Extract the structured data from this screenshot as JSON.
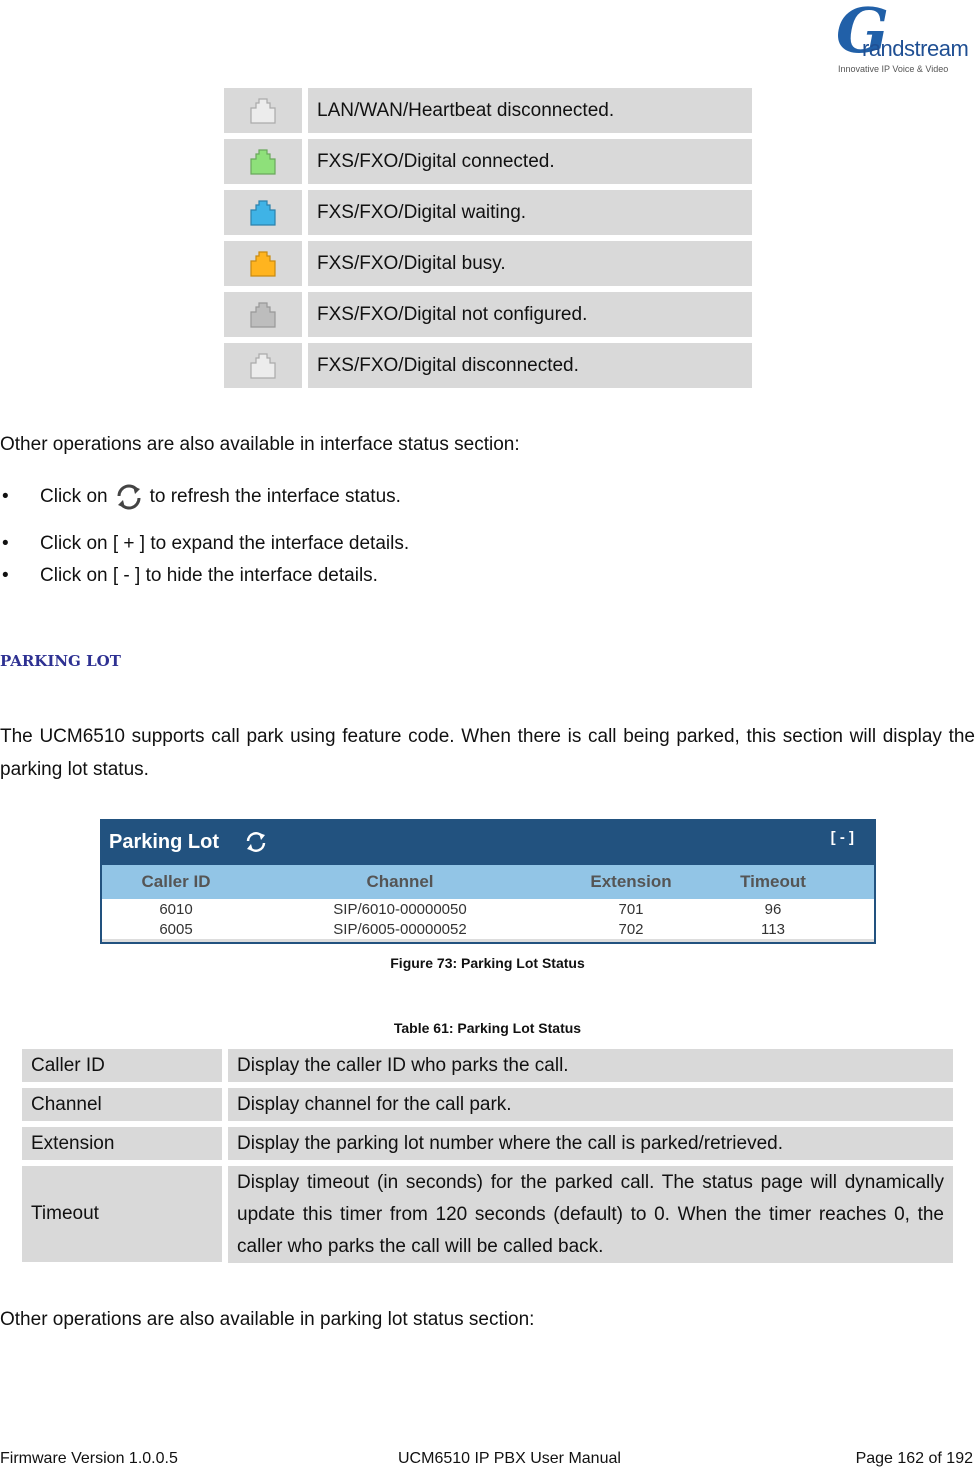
{
  "brand": {
    "logo_letter": "G",
    "logo_word": "randstream",
    "tagline": "Innovative IP Voice & Video"
  },
  "status_legend": [
    {
      "icon": "port-icon-disconnected-lan",
      "color": "#ececec",
      "stroke": "#aaaaaa",
      "label": "LAN/WAN/Heartbeat disconnected."
    },
    {
      "icon": "port-icon-connected",
      "color": "#8ee07a",
      "stroke": "#6aa85c",
      "label": "FXS/FXO/Digital connected."
    },
    {
      "icon": "port-icon-waiting",
      "color": "#3fb3e6",
      "stroke": "#2b82ad",
      "label": "FXS/FXO/Digital waiting."
    },
    {
      "icon": "port-icon-busy",
      "color": "#ffb41f",
      "stroke": "#c98a10",
      "label": "FXS/FXO/Digital busy."
    },
    {
      "icon": "port-icon-not-configured",
      "color": "#bdbdbd",
      "stroke": "#999999",
      "label": "FXS/FXO/Digital not configured."
    },
    {
      "icon": "port-icon-disconnected",
      "color": "#ececec",
      "stroke": "#aaaaaa",
      "label": "FXS/FXO/Digital disconnected."
    }
  ],
  "interface_ops": {
    "intro": "Other operations are also available in interface status section:",
    "bullets": [
      {
        "before": "Click on",
        "after": "to refresh the interface status.",
        "icon": "refresh-icon"
      },
      {
        "text": "Click on [ + ] to expand the interface details."
      },
      {
        "text": "Click on [ - ] to hide the interface details."
      }
    ]
  },
  "section_title": "PARKING LOT",
  "section_body": "The UCM6510 supports call park using feature code. When there is call being parked, this section will display the parking lot status.",
  "widget": {
    "title": "Parking Lot",
    "toggle": "[ - ]",
    "header_color": "#22527f",
    "columns_color": "#92c5e6",
    "columns": [
      "Caller ID",
      "Channel",
      "Extension",
      "Timeout"
    ],
    "rows": [
      [
        "6010",
        "SIP/6010-00000050",
        "701",
        "96"
      ],
      [
        "6005",
        "SIP/6005-00000052",
        "702",
        "113"
      ]
    ]
  },
  "figure_caption": "Figure 73: Parking Lot Status",
  "table_caption": "Table 61: Parking Lot Status",
  "table": [
    {
      "key": "Caller ID",
      "value": "Display the caller ID who parks the call."
    },
    {
      "key": "Channel",
      "value": "Display channel for the call park."
    },
    {
      "key": "Extension",
      "value": "Display the parking lot number where the call is parked/retrieved."
    },
    {
      "key": "Timeout",
      "value": "Display timeout (in seconds) for the parked call. The status page will dynamically update this timer from 120 seconds (default) to 0. When the timer reaches 0, the caller who parks the call will be called back."
    }
  ],
  "closing": "Other operations are also available in parking lot status section:",
  "footer": {
    "left": "Firmware Version 1.0.0.5",
    "center": "UCM6510 IP PBX User Manual",
    "right": "Page 162 of 192"
  }
}
